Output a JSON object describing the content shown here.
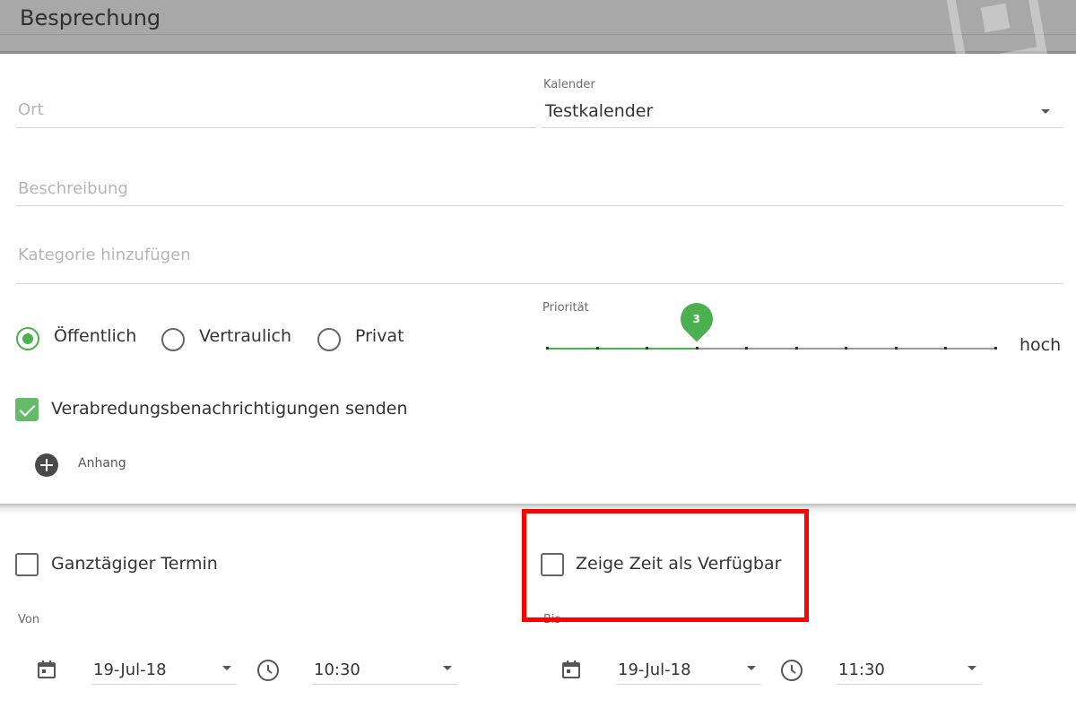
{
  "header": {
    "title": "Besprechung"
  },
  "location": {
    "placeholder": "Ort",
    "value": ""
  },
  "calendar": {
    "label": "Kalender",
    "value": "Testkalender"
  },
  "description": {
    "placeholder": "Beschreibung",
    "value": ""
  },
  "category": {
    "placeholder": "Kategorie hinzufügen",
    "value": ""
  },
  "visibility": {
    "options": [
      {
        "label": "Öffentlich",
        "selected": true
      },
      {
        "label": "Vertraulich",
        "selected": false
      },
      {
        "label": "Privat",
        "selected": false
      }
    ]
  },
  "priority": {
    "label": "Priorität",
    "value": 3,
    "max_label": "hoch",
    "min": 0,
    "max": 9,
    "accent": "#4caf50"
  },
  "notifications": {
    "label": "Verabredungsbenachrichtigungen senden",
    "checked": true
  },
  "attachment": {
    "label": "Anhang"
  },
  "all_day": {
    "label": "Ganztägiger Termin",
    "checked": false
  },
  "show_free": {
    "label": "Zeige Zeit als Verfügbar",
    "checked": false
  },
  "from": {
    "label": "Von",
    "date": "19-Jul-18",
    "time": "10:30"
  },
  "to": {
    "label": "Bis",
    "date": "19-Jul-18",
    "time": "11:30"
  },
  "icons": {
    "calendar": "calendar-icon",
    "clock": "clock-icon",
    "add": "add-circle-icon",
    "dropdown": "caret-down-icon"
  },
  "colors": {
    "accent": "#4caf50",
    "highlight": "#ff0000"
  }
}
